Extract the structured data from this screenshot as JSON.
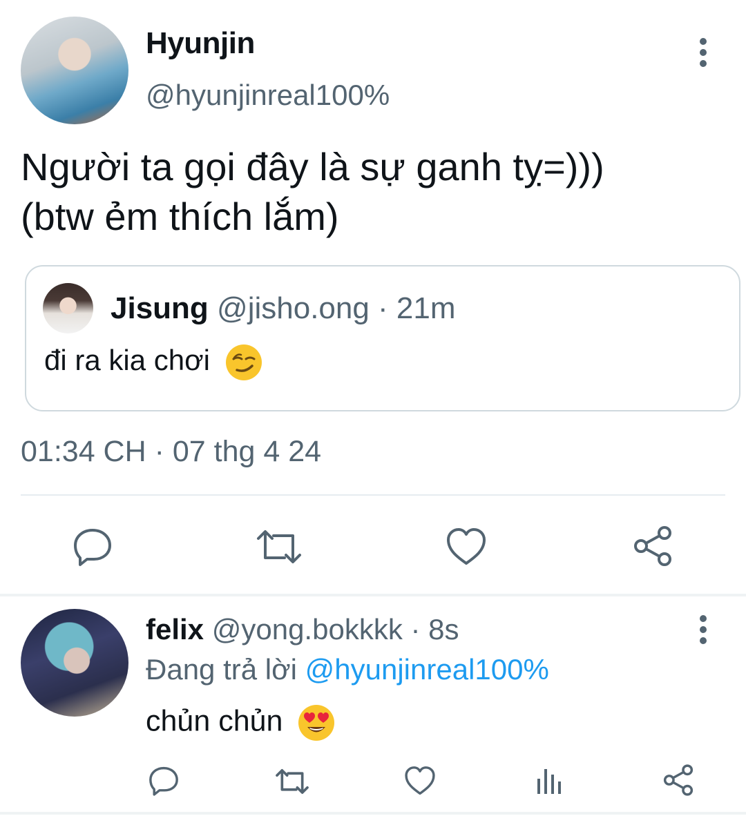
{
  "tweet": {
    "author_name": "Hyunjin",
    "author_handle": "@hyunjinreal100%",
    "text_line1": "Người ta gọi đây là sự ganh tỵ=)))",
    "text_line2": "(btw ẻm thích lắm)",
    "timestamp": "01:34 CH · 07 thg 4 24",
    "more_icon": "more-vertical-icon"
  },
  "quoted": {
    "author_name": "Jisung",
    "meta": "@jisho.ong · 21m",
    "text": "đi ra kia chơi",
    "emoji": "smirking-face"
  },
  "actions": [
    "reply-icon",
    "retweet-icon",
    "like-icon",
    "share-icon"
  ],
  "reply": {
    "author_name": "felix",
    "meta": "@yong.bokkkk · 8s",
    "replying_prefix": "Đang trả lời",
    "replying_to": "@hyunjinreal100%",
    "text": "chủn chủn",
    "emoji": "heart-eyes-face",
    "actions": [
      "reply-icon",
      "retweet-icon",
      "like-icon",
      "analytics-icon",
      "share-icon"
    ]
  },
  "colors": {
    "text_primary": "#0f1419",
    "text_secondary": "#536471",
    "link": "#1d9bf0",
    "border": "#cfd9de"
  }
}
